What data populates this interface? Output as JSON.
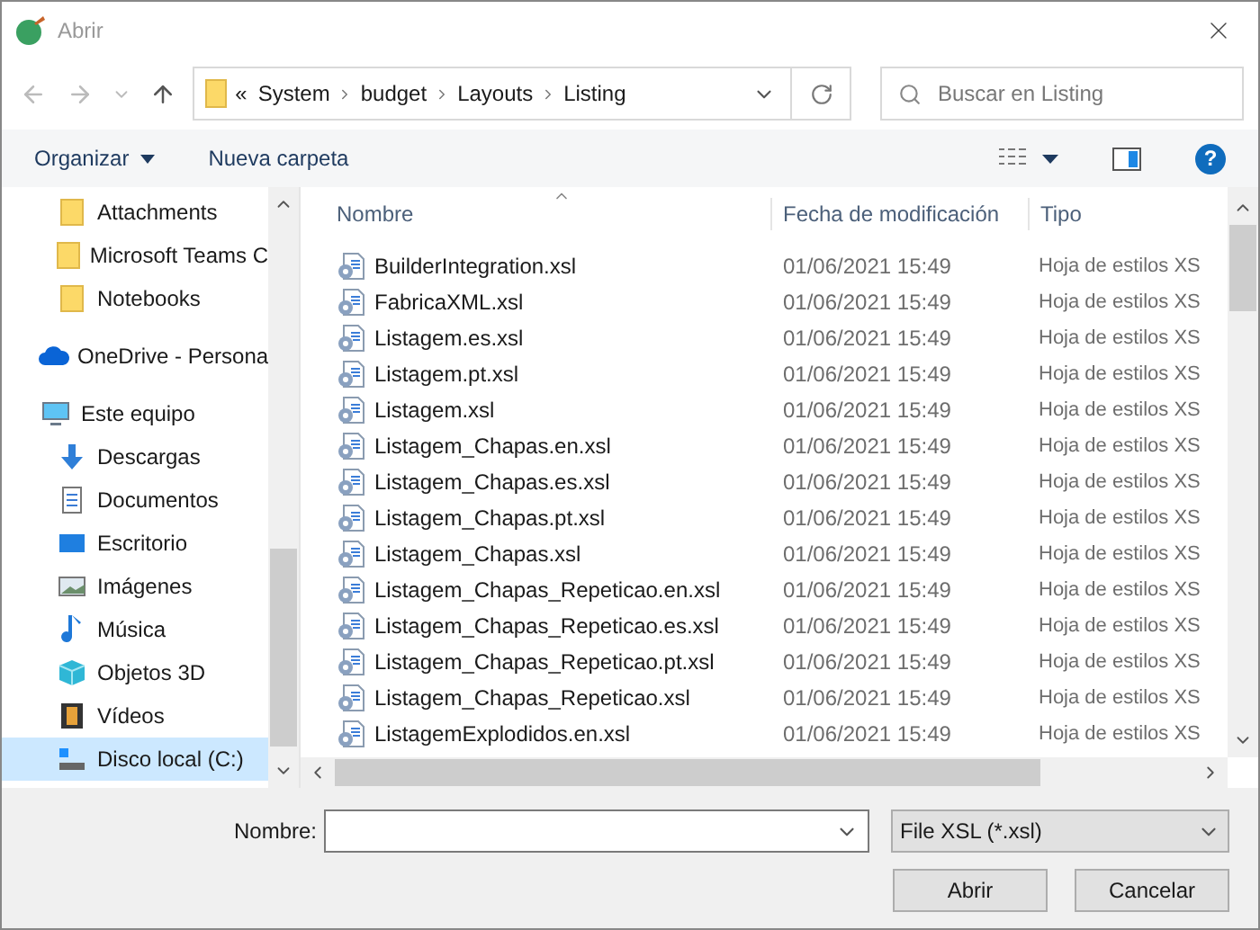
{
  "window": {
    "title": "Abrir"
  },
  "address": {
    "overflow": "«",
    "crumbs": [
      "System",
      "budget",
      "Layouts",
      "Listing"
    ]
  },
  "search": {
    "placeholder": "Buscar en Listing"
  },
  "toolbar": {
    "organize": "Organizar",
    "new_folder": "Nueva carpeta",
    "help": "?"
  },
  "sidebar": {
    "pinned": [
      {
        "label": "Attachments",
        "kind": "folder",
        "selected": false
      },
      {
        "label": "Microsoft Teams C",
        "kind": "folder",
        "selected": false
      },
      {
        "label": "Notebooks",
        "kind": "folder",
        "selected": false
      }
    ],
    "items": [
      {
        "label": "OneDrive - Persona",
        "kind": "onedrive",
        "selected": false
      },
      {
        "label": "Este equipo",
        "kind": "pc",
        "selected": false,
        "children": [
          {
            "label": "Descargas",
            "kind": "downloads",
            "selected": false
          },
          {
            "label": "Documentos",
            "kind": "documents",
            "selected": false
          },
          {
            "label": "Escritorio",
            "kind": "desktop",
            "selected": false
          },
          {
            "label": "Imágenes",
            "kind": "pictures",
            "selected": false
          },
          {
            "label": "Música",
            "kind": "music",
            "selected": false
          },
          {
            "label": "Objetos 3D",
            "kind": "objects3d",
            "selected": false
          },
          {
            "label": "Vídeos",
            "kind": "videos",
            "selected": false
          },
          {
            "label": "Disco local (C:)",
            "kind": "drive",
            "selected": true
          }
        ]
      }
    ]
  },
  "table": {
    "columns": [
      "Nombre",
      "Fecha de modificación",
      "Tipo"
    ],
    "rows": [
      {
        "name": "BuilderIntegration.xsl",
        "date": "01/06/2021 15:49",
        "type": "Hoja de estilos XS"
      },
      {
        "name": "FabricaXML.xsl",
        "date": "01/06/2021 15:49",
        "type": "Hoja de estilos XS"
      },
      {
        "name": "Listagem.es.xsl",
        "date": "01/06/2021 15:49",
        "type": "Hoja de estilos XS"
      },
      {
        "name": "Listagem.pt.xsl",
        "date": "01/06/2021 15:49",
        "type": "Hoja de estilos XS"
      },
      {
        "name": "Listagem.xsl",
        "date": "01/06/2021 15:49",
        "type": "Hoja de estilos XS"
      },
      {
        "name": "Listagem_Chapas.en.xsl",
        "date": "01/06/2021 15:49",
        "type": "Hoja de estilos XS"
      },
      {
        "name": "Listagem_Chapas.es.xsl",
        "date": "01/06/2021 15:49",
        "type": "Hoja de estilos XS"
      },
      {
        "name": "Listagem_Chapas.pt.xsl",
        "date": "01/06/2021 15:49",
        "type": "Hoja de estilos XS"
      },
      {
        "name": "Listagem_Chapas.xsl",
        "date": "01/06/2021 15:49",
        "type": "Hoja de estilos XS"
      },
      {
        "name": "Listagem_Chapas_Repeticao.en.xsl",
        "date": "01/06/2021 15:49",
        "type": "Hoja de estilos XS"
      },
      {
        "name": "Listagem_Chapas_Repeticao.es.xsl",
        "date": "01/06/2021 15:49",
        "type": "Hoja de estilos XS"
      },
      {
        "name": "Listagem_Chapas_Repeticao.pt.xsl",
        "date": "01/06/2021 15:49",
        "type": "Hoja de estilos XS"
      },
      {
        "name": "Listagem_Chapas_Repeticao.xsl",
        "date": "01/06/2021 15:49",
        "type": "Hoja de estilos XS"
      },
      {
        "name": "ListagemExplodidos.en.xsl",
        "date": "01/06/2021 15:49",
        "type": "Hoja de estilos XS"
      }
    ]
  },
  "footer": {
    "name_label": "Nombre:",
    "filter": "File XSL (*.xsl)",
    "buttons": [
      "Abrir",
      "Cancelar"
    ]
  }
}
